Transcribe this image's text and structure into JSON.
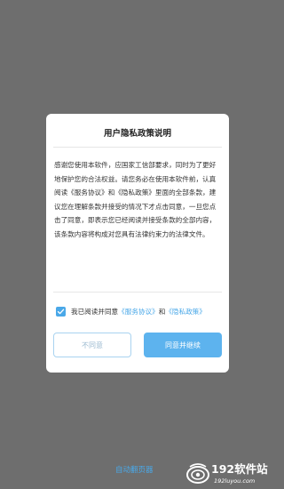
{
  "dialog": {
    "title": "用户隐私政策说明",
    "body": "感谢您使用本软件，应国家工信部要求，同时为了更好地保护您的合法权益。请您务必在使用本软件前，认真阅读《服务协议》和《隐私政策》里面的全部条款，建议您在理解条款并接受的情况下才点击同意，一旦您点击了同意，即表示您已经阅读并接受条款的全部内容，该条款内容将构成对您具有法律约束力的法律文件。",
    "agree": {
      "checked": true,
      "prefix": "我已阅读并同意",
      "service_link": "《服务协议》",
      "and": "和",
      "privacy_link": "《隐私政策》"
    },
    "decline_button": "不同意",
    "accept_button": "同意并继续"
  },
  "bottom": {
    "link_text": "自动翻页器"
  },
  "watermark": {
    "brand": "192软件站",
    "url": "192luyou.com"
  },
  "colors": {
    "accent": "#4aa8e8",
    "overlay": "#6e6e6e",
    "accept_button": "#5db3ee"
  }
}
